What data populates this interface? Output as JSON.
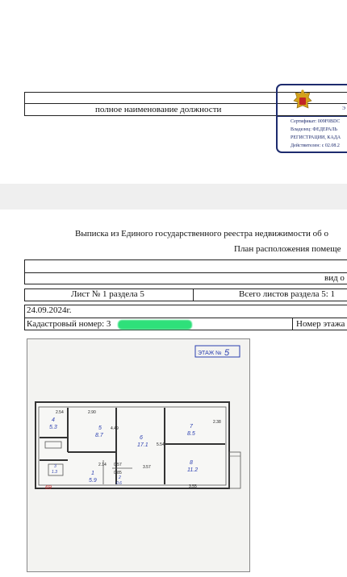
{
  "top_doc": {
    "position_caption": "полное наименование должности",
    "stamp": {
      "title_fragment": "Э",
      "cert_line": "Сертификат: 009F0BDC",
      "owner_line": "Владелец: ФЕДЕРАЛЬ",
      "org_line": "РЕГИСТРАЦИИ, КАДА",
      "valid_line": "Действителен: с 02.08.2"
    }
  },
  "bottom_doc": {
    "heading": "Выписка из Единого государственного реестра недвижимости об о",
    "subheading": "План расположения помеще",
    "view_cell": "вид о",
    "sheet_label": "Лист № 1 раздела 5",
    "total_sheets": "Всего листов раздела 5: 1",
    "date": "24.09.2024г.",
    "cadastral_label": "Кадастровый номер: 3",
    "floor_number_label": "Номер этажа"
  },
  "floor_plan": {
    "stamp_label": "ЭТАЖ №",
    "stamp_number": "5",
    "dimensions": [
      "2.54",
      "2.90",
      "4.49",
      "5.54",
      "2.38",
      "2.14",
      "0.57",
      "0.85",
      "3.57",
      "3.55"
    ],
    "rooms": [
      {
        "num": "4",
        "area": "5.3"
      },
      {
        "num": "5",
        "area": "8.7"
      },
      {
        "num": "6",
        "area": "17.1"
      },
      {
        "num": "7",
        "area": "8.5"
      },
      {
        "num": "8",
        "area": "11.2"
      },
      {
        "num": "1",
        "area": "5.9"
      },
      {
        "num": "2",
        "area": "0.6"
      },
      {
        "num": "3",
        "area": "1.3"
      }
    ],
    "apartment_label": "69"
  }
}
